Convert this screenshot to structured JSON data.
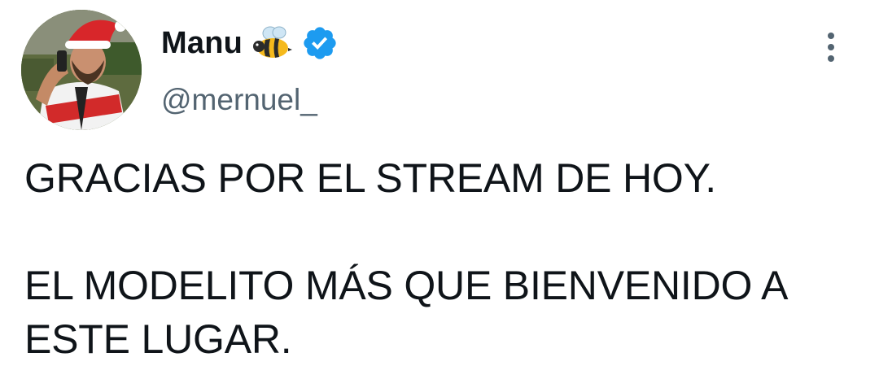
{
  "tweet": {
    "author": {
      "display_name": "Manu",
      "handle": "@mernuel_",
      "emoji_icon": "bee-icon",
      "verified_icon": "verified-badge-icon",
      "verified_color": "#1d9bf0"
    },
    "body": {
      "paragraph_1": "GRACIAS POR EL STREAM DE HOY.",
      "paragraph_2_line_1": "EL MODELITO MÁS QUE BIENVENIDO A",
      "paragraph_2_line_2": "ESTE LUGAR."
    },
    "menu_icon": "more-vertical-icon"
  }
}
